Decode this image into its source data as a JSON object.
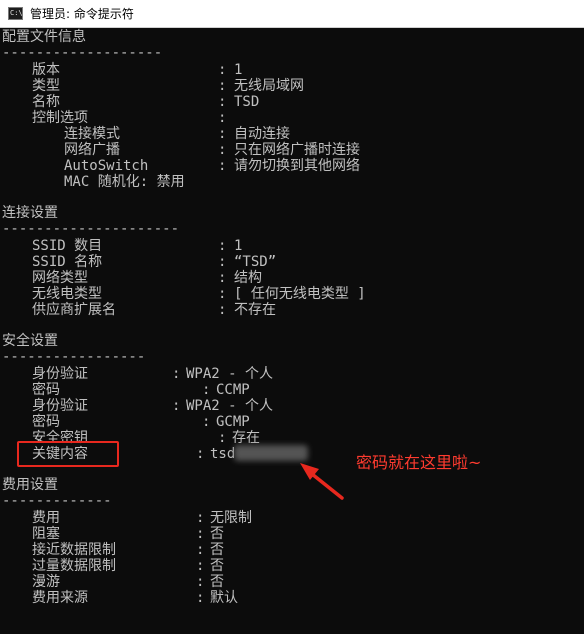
{
  "window": {
    "title": "管理员: 命令提示符",
    "icon": "cmd-icon",
    "icon_text": "C:\\"
  },
  "profile": {
    "header": "配置文件信息",
    "rule": "-------------------",
    "version_label": "版本",
    "version_value": "1",
    "type_label": "类型",
    "type_value": "无线局域网",
    "name_label": "名称",
    "name_value": "TSD",
    "control_label": "控制选项",
    "connect_mode_label": "连接模式",
    "connect_mode_value": "自动连接",
    "broadcast_label": "网络广播",
    "broadcast_value": "只在网络广播时连接",
    "autoswitch_label": "AutoSwitch",
    "autoswitch_value": "请勿切换到其他网络",
    "mac_label": "MAC 随机化: 禁用"
  },
  "connectivity": {
    "header": "连接设置",
    "rule": "---------------------",
    "ssid_count_label": "SSID 数目",
    "ssid_count_value": "1",
    "ssid_name_label": "SSID 名称",
    "ssid_name_value": "“TSD”",
    "net_type_label": "网络类型",
    "net_type_value": "结构",
    "radio_type_label": "无线电类型",
    "radio_type_value": "[ 任何无线电类型 ]",
    "vendor_ext_label": "供应商扩展名",
    "vendor_ext_value": "不存在"
  },
  "security": {
    "header": "安全设置",
    "rule": "-----------------",
    "auth1_label": "身份验证",
    "auth1_value": "WPA2 - 个人",
    "cipher1_label": "密码",
    "cipher1_value": "CCMP",
    "auth2_label": "身份验证",
    "auth2_value": "WPA2 - 个人",
    "cipher2_label": "密码",
    "cipher2_value": "GCMP",
    "key_label": "安全密钥",
    "key_value": "存在",
    "key_content_label": "关键内容",
    "key_content_value": "tsd"
  },
  "cost": {
    "header": "费用设置",
    "rule": "-------------",
    "cost_label": "费用",
    "cost_value": "无限制",
    "congested_label": "阻塞",
    "congested_value": "否",
    "approaching_label": "接近数据限制",
    "approaching_value": "否",
    "over_label": "过量数据限制",
    "over_value": "否",
    "roaming_label": "漫游",
    "roaming_value": "否",
    "source_label": "费用来源",
    "source_value": "默认"
  },
  "annotation": {
    "note": "密码就在这里啦~",
    "color": "#e8281e"
  },
  "colors": {
    "console_bg": "#0c0c0c",
    "console_text": "#c0c0c0"
  }
}
